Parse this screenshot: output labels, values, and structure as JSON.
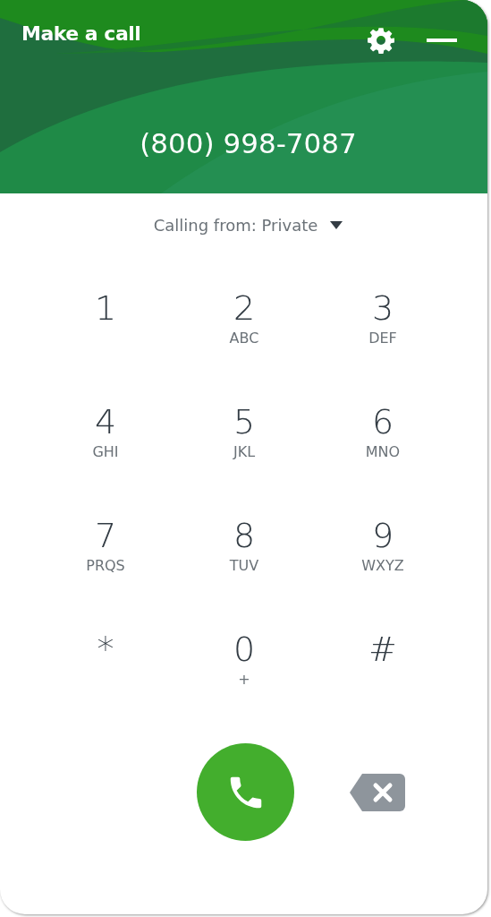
{
  "header": {
    "title": "Make a call",
    "number": "(800) 998-7087"
  },
  "calling_from": {
    "label": "Calling from: Private"
  },
  "keypad": [
    {
      "digit": "1"
    },
    {
      "digit": "2",
      "letters": "ABC"
    },
    {
      "digit": "3",
      "letters": "DEF"
    },
    {
      "digit": "4",
      "letters": "GHI"
    },
    {
      "digit": "5",
      "letters": "JKL"
    },
    {
      "digit": "6",
      "letters": "MNO"
    },
    {
      "digit": "7",
      "letters": "PRQS"
    },
    {
      "digit": "8",
      "letters": "TUV"
    },
    {
      "digit": "9",
      "letters": "WXYZ"
    },
    {
      "digit": "*"
    },
    {
      "digit": "0",
      "letters": "+"
    },
    {
      "digit": "#"
    }
  ]
}
